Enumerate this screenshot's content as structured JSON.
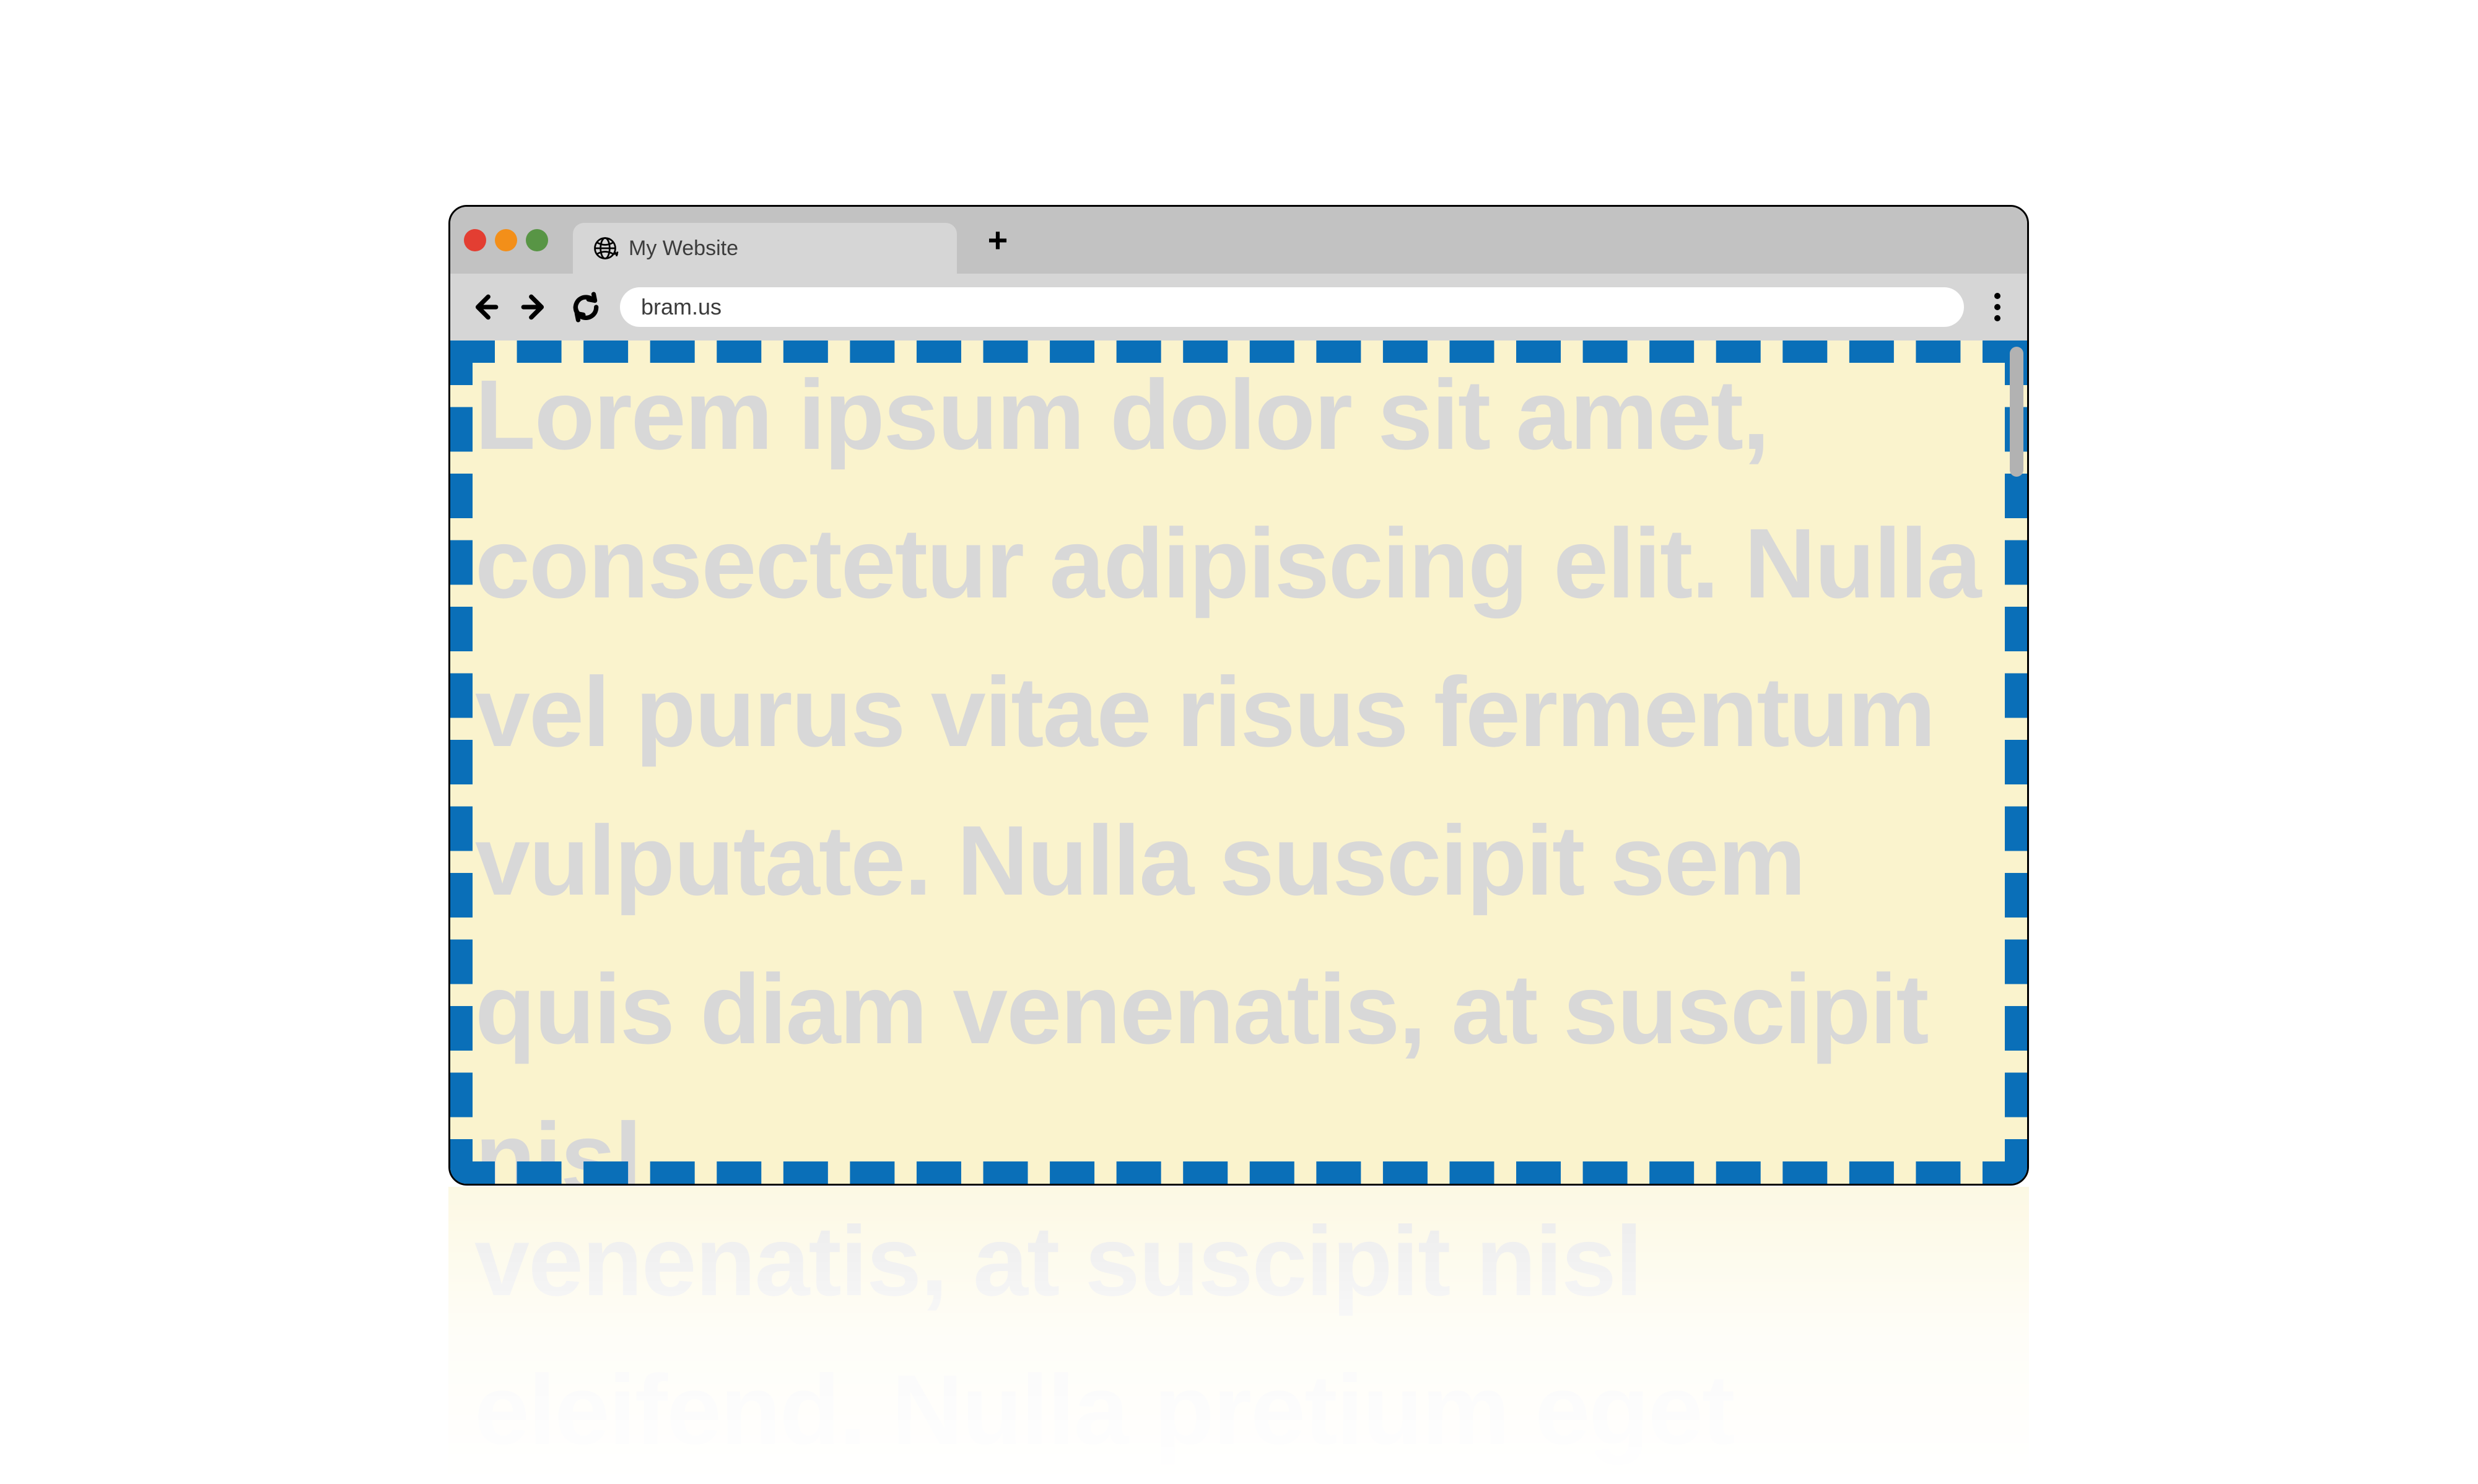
{
  "window": {
    "tab_title": "My Website",
    "address": "bram.us"
  },
  "page": {
    "visible_text": "Lorem ipsum dolor sit amet, consectetur adipiscing elit. Nulla vel purus vitae risus fermentum vulputate. Nulla suscipit sem quis diam venenatis, at suscipit nisl",
    "overflow_text": "venenatis, at suscipit nisl eleifend. Nulla pretium eget"
  },
  "colors": {
    "viewport_bg": "#faf3cd",
    "dashed_border": "#0a6fb8",
    "body_text": "#d8d8d8"
  }
}
